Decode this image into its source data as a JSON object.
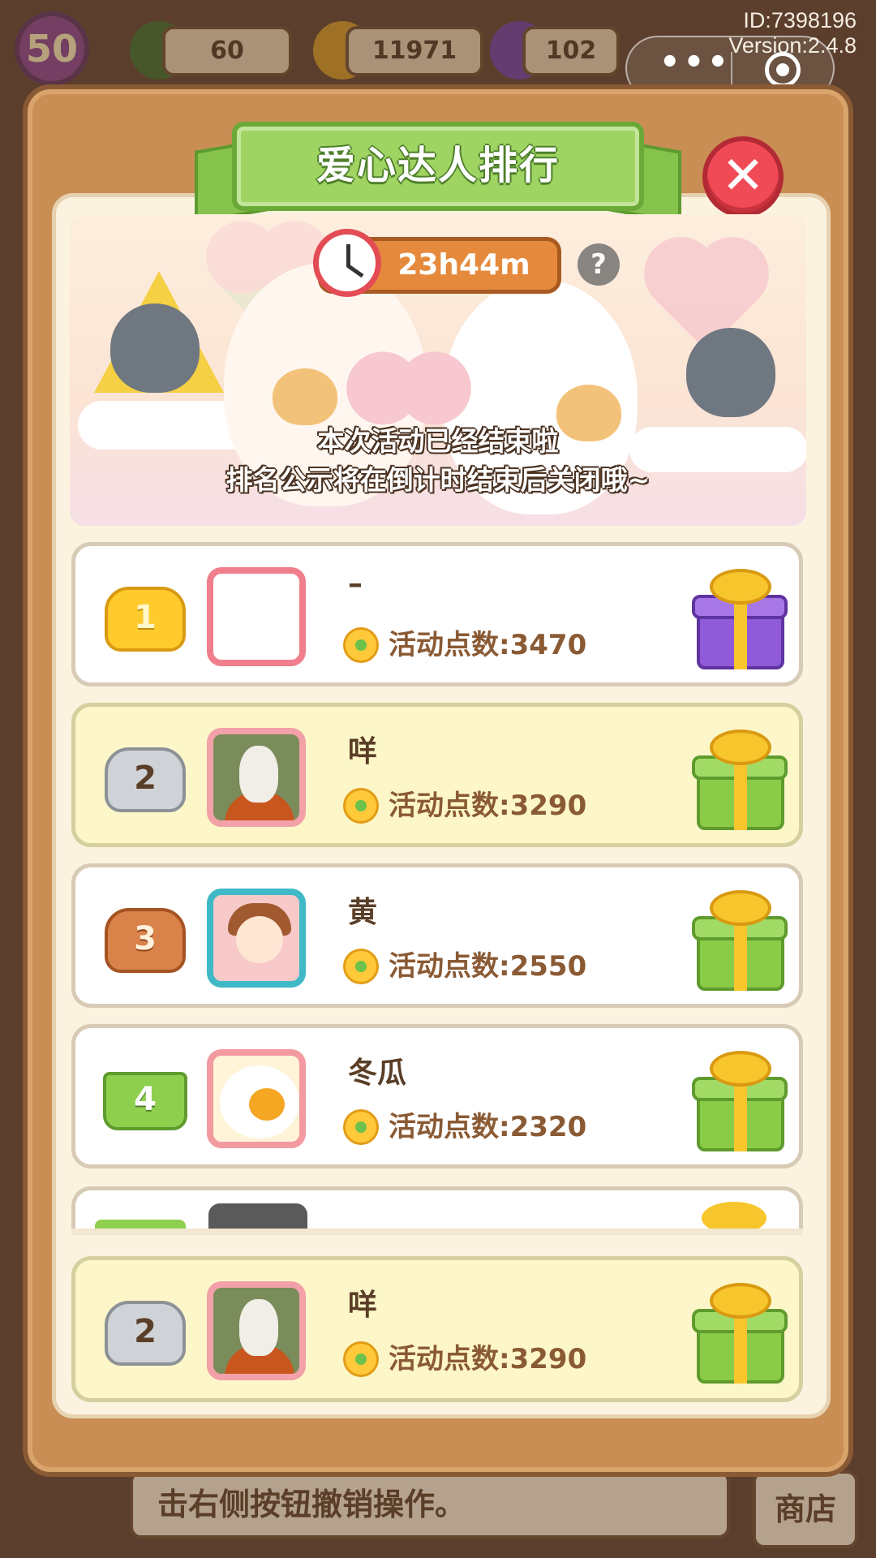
{
  "hud": {
    "level": "50",
    "energy": "60",
    "coins": "11971",
    "gems": "102",
    "id_text": "ID:7398196",
    "version_text": "Version:2.4.8",
    "menu_dots": "•••"
  },
  "modal": {
    "title": "爱心达人排行",
    "close_glyph": "✕",
    "timer": "23h44m",
    "help_glyph": "?",
    "message_line1": "本次活动已经结束啦",
    "message_line2": "排名公示将在倒计时结束后关闭哦~"
  },
  "score_prefix": "活动点数:",
  "rankings": [
    {
      "rank": "1",
      "name": "–",
      "score": "活动点数:3470",
      "gift": "purple-gift-icon"
    },
    {
      "rank": "2",
      "name": "咩",
      "score": "活动点数:3290",
      "gift": "green-gift-icon"
    },
    {
      "rank": "3",
      "name": "黄",
      "score": "活动点数:2550",
      "gift": "green-gift-icon"
    },
    {
      "rank": "4",
      "name": "冬瓜",
      "score": "活动点数:2320",
      "gift": "green-gift-icon"
    }
  ],
  "self_rank": {
    "rank": "2",
    "name": "咩",
    "score": "活动点数:3290",
    "gift": "green-gift-icon"
  },
  "bottom": {
    "hint_text": "击右侧按钮撤销操作。",
    "shop_label": "商店"
  },
  "colors": {
    "panel": "#c98e54",
    "ribbon": "#9fd463",
    "close": "#ef4a56",
    "self_row": "#fdf6c9"
  }
}
